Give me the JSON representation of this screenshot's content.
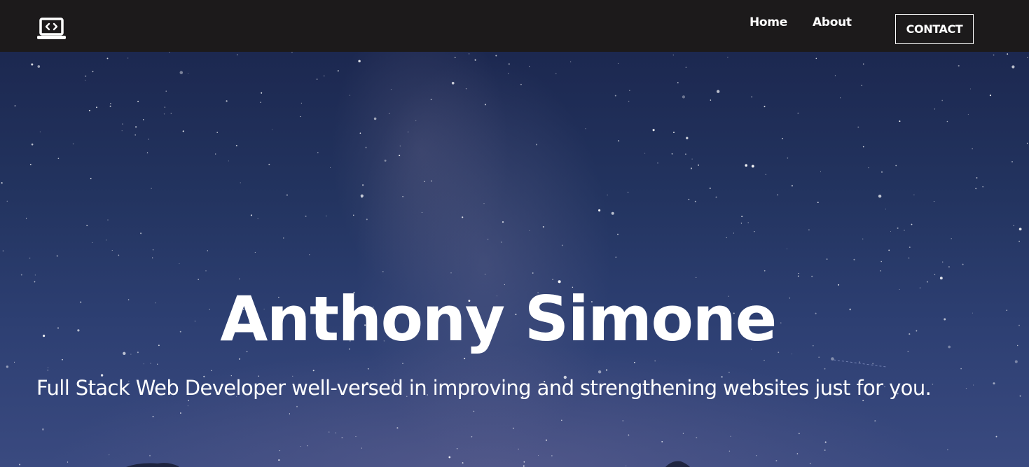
{
  "navbar": {
    "logo_icon": "laptop-code-icon",
    "links": [
      {
        "label": "Home"
      },
      {
        "label": "About"
      }
    ],
    "contact_label": "CONTACT"
  },
  "hero": {
    "title": "Anthony Simone",
    "subtitle": "Full Stack Web Developer well-versed in improving and strengthening websites just for you.",
    "background": "starry-night-sky"
  },
  "colors": {
    "navbar_bg": "#1c1a1b",
    "text": "#ffffff",
    "sky_top": "#1c2850",
    "sky_bottom": "#3a4a80"
  }
}
